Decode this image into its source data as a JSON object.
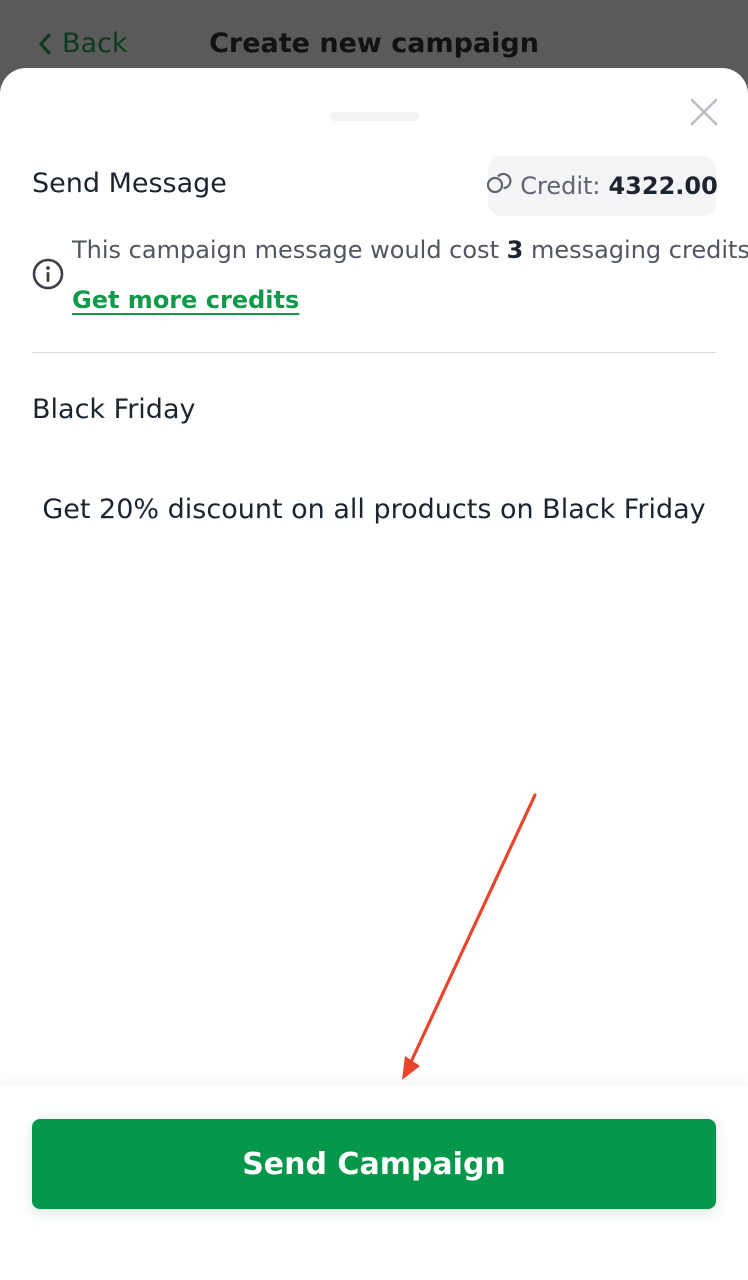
{
  "background_page": {
    "back_label": "Back",
    "title": "Create new campaign"
  },
  "sheet": {
    "title": "Send Message",
    "credit": {
      "label": "Credit:",
      "value": "4322.00"
    },
    "info": {
      "text_before": "This campaign message would cost ",
      "cost": "3",
      "text_after": " messaging credits.",
      "link_label": "Get more credits"
    },
    "campaign": {
      "name": "Black Friday",
      "message": "Get 20% discount on all products on Black Friday"
    },
    "send_button_label": "Send Campaign"
  },
  "colors": {
    "primary_green": "#05974a",
    "link_green": "#119a49",
    "annotation_arrow": "#e8452c"
  },
  "icons": {
    "back": "chevron-left-icon",
    "close": "close-icon",
    "credit": "coins-icon",
    "info": "info-circle-icon"
  }
}
